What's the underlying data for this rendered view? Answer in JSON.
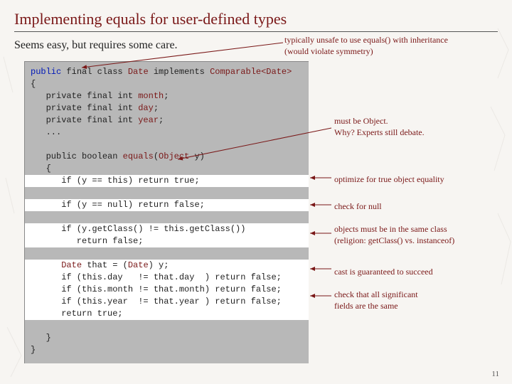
{
  "title": "Implementing equals for user-defined types",
  "subtitle": "Seems easy, but requires some care.",
  "top_note_l1": "typically unsafe to use equals() with inheritance",
  "top_note_l2": "(would violate symmetry)",
  "code": {
    "l1_a": "public",
    "l1_b": " final class ",
    "l1_c": "Date",
    "l1_d": " implements ",
    "l1_e": "Comparable<Date>",
    "l2": "{",
    "l3_a": "   private final int ",
    "l3_b": "month",
    "l3_c": ";",
    "l4_a": "   private final int ",
    "l4_b": "day",
    "l4_c": ";",
    "l5_a": "   private final int ",
    "l5_b": "year",
    "l5_c": ";",
    "l6": "   ...",
    "l7_a": "   public boolean ",
    "l7_b": "equals",
    "l7_c": "(",
    "l7_d": "Object",
    "l7_e": " y)",
    "l8": "   {",
    "h1": "      if (y == this) return true;",
    "h2": "      if (y == null) return false;",
    "h3a": "      if (y.getClass() != this.getClass())",
    "h3b": "         return false;",
    "h4a_a": "      ",
    "h4a_b": "Date",
    "h4a_c": " that = (",
    "h4a_d": "Date",
    "h4a_e": ") y;",
    "h4b": "      if (this.day   != that.day  ) return false;",
    "h4c": "      if (this.month != that.month) return false;",
    "h4d": "      if (this.year  != that.year ) return false;",
    "h4e": "      return true;",
    "l9": "   }",
    "l10": "}"
  },
  "annot": {
    "a1_l1": "must be Object.",
    "a1_l2": "Why? Experts still debate.",
    "a2": "optimize for true object equality",
    "a3": "check for null",
    "a4_l1": "objects must be in the same class",
    "a4_l2": "(religion: getClass() vs. instanceof)",
    "a5": "cast is guaranteed to succeed",
    "a6_l1": "check that all significant",
    "a6_l2": "fields are the same"
  },
  "page_number": "11"
}
